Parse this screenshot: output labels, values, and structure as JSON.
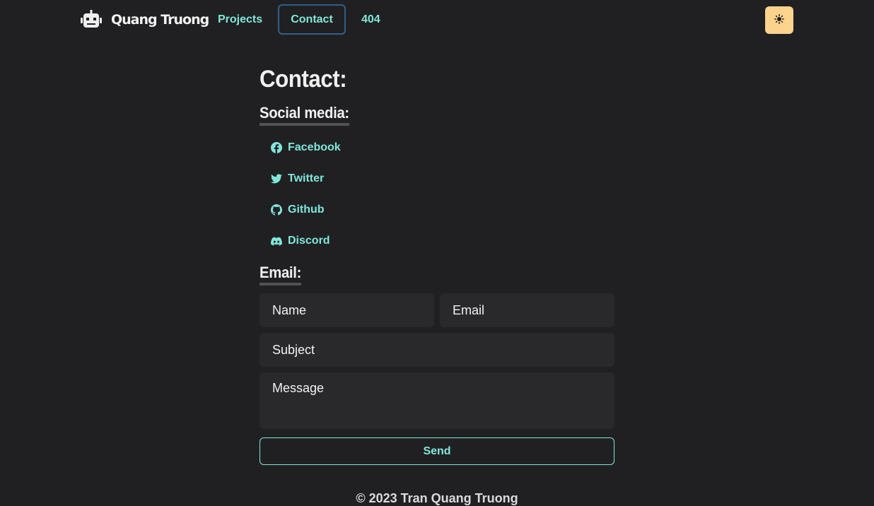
{
  "header": {
    "brand_name": "Quang Truong",
    "nav_links": [
      "Projects",
      "Contact",
      "404"
    ],
    "active_link": "Contact",
    "theme_toggle_icon": "sun-icon",
    "accent_color": "#81e6d9",
    "theme_button_color": "#fbd38d"
  },
  "main": {
    "title": "Contact:",
    "social_title": "Social media:",
    "social_links": [
      {
        "label": "Facebook",
        "icon": "facebook-icon"
      },
      {
        "label": "Twitter",
        "icon": "twitter-icon"
      },
      {
        "label": "Github",
        "icon": "github-icon"
      },
      {
        "label": "Discord",
        "icon": "discord-icon"
      }
    ],
    "email_title": "Email:",
    "form": {
      "name_placeholder": "Name",
      "email_placeholder": "Email",
      "subject_placeholder": "Subject",
      "message_placeholder": "Message",
      "send_label": "Send"
    }
  },
  "footer": {
    "text": "© 2023 Tran Quang Truong"
  }
}
